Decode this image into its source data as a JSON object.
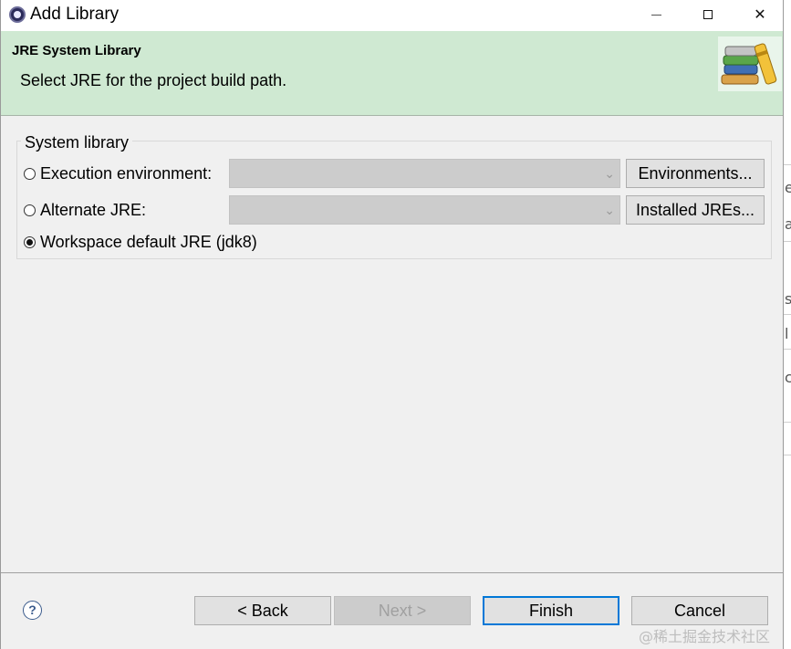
{
  "window": {
    "title": "Add Library",
    "controls": {
      "minimize": "",
      "maximize": "",
      "close": "✕"
    }
  },
  "banner": {
    "title": "JRE System Library",
    "message": "Select JRE for the project build path.",
    "icon": "library-books-icon"
  },
  "system_library": {
    "legend": "System library",
    "options": [
      {
        "label": "Execution environment:",
        "selected": false,
        "combo_value": "",
        "button": "Environments..."
      },
      {
        "label": "Alternate JRE:",
        "selected": false,
        "combo_value": "",
        "button": "Installed JREs..."
      },
      {
        "label": "Workspace default JRE (jdk8)",
        "selected": true
      }
    ]
  },
  "footer": {
    "help_icon": "?",
    "back": "< Back",
    "next": "Next >",
    "finish": "Finish",
    "cancel": "Cancel"
  },
  "watermark": "@稀土掘金技术社区",
  "background_glyphs": [
    "e",
    "a",
    "s",
    "l",
    "c"
  ],
  "colors": {
    "banner": "#cfe9d2",
    "dialog": "#f0f0f0",
    "default_button_border": "#0078d7"
  }
}
